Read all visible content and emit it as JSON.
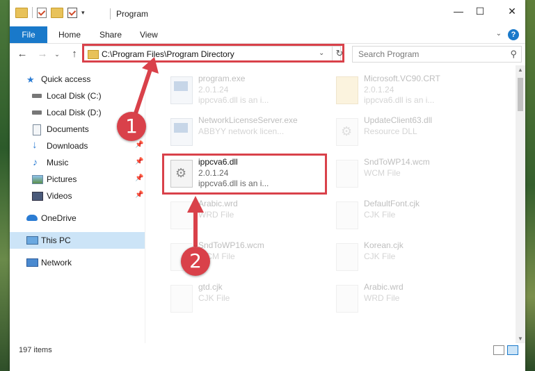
{
  "window": {
    "title": "Program",
    "minimize": "—",
    "maximize": "☐",
    "close": "✕"
  },
  "ribbon": {
    "tabs": [
      "File",
      "Home",
      "Share",
      "View"
    ],
    "help": "?"
  },
  "address": {
    "path": "C:\\Program Files\\Program Directory",
    "search_placeholder": "Search Program"
  },
  "sidebar": {
    "items": [
      {
        "label": "Quick access",
        "icon": "star-icon"
      },
      {
        "label": "Local Disk (C:)",
        "icon": "drive-icon"
      },
      {
        "label": "Local Disk (D:)",
        "icon": "drive-icon"
      },
      {
        "label": "Documents",
        "icon": "documents-icon"
      },
      {
        "label": "Downloads",
        "icon": "download-icon"
      },
      {
        "label": "Music",
        "icon": "music-icon"
      },
      {
        "label": "Pictures",
        "icon": "pictures-icon"
      },
      {
        "label": "Videos",
        "icon": "videos-icon"
      },
      {
        "label": "OneDrive",
        "icon": "cloud-icon"
      },
      {
        "label": "This PC",
        "icon": "computer-icon"
      },
      {
        "label": "Network",
        "icon": "network-icon"
      }
    ]
  },
  "files": [
    {
      "name": "program.exe",
      "version": "2.0.1.24",
      "desc": "ippcva6.dll is an i..."
    },
    {
      "name": "Microsoft.VC90.CRT",
      "version": "2.0.1.24",
      "desc": "ippcva6.dll is an i..."
    },
    {
      "name": "NetworkLicenseServer.exe",
      "version": "ABBYY network licen...",
      "desc": ""
    },
    {
      "name": "UpdateClient63.dll",
      "version": "Resource DLL",
      "desc": ""
    },
    {
      "name": "ippcva6.dll",
      "version": "2.0.1.24",
      "desc": "ippcva6.dll is an i..."
    },
    {
      "name": "SndToWP14.wcm",
      "version": "WCM File",
      "desc": ""
    },
    {
      "name": "Arabic.wrd",
      "version": "WRD File",
      "desc": ""
    },
    {
      "name": "DefaultFont.cjk",
      "version": "CJK File",
      "desc": ""
    },
    {
      "name": "SndToWP16.wcm",
      "version": "WCM File",
      "desc": ""
    },
    {
      "name": "Korean.cjk",
      "version": "CJK File",
      "desc": ""
    },
    {
      "name": "gtd.cjk",
      "version": "CJK File",
      "desc": ""
    },
    {
      "name": "Arabic.wrd",
      "version": "WRD File",
      "desc": ""
    }
  ],
  "status": {
    "count": "197 items"
  },
  "annotations": {
    "step1": "1",
    "step2": "2",
    "color": "#d9414a"
  }
}
